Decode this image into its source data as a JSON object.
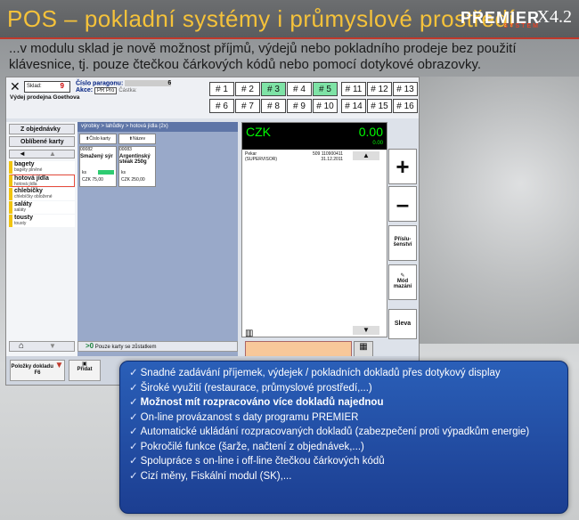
{
  "header": {
    "title": "POS – pokladní systémy i průmyslové prostředí",
    "brand": "PREMIER",
    "brand_sub": "SYSTEM",
    "version": "X4.2"
  },
  "intro_text": "...v modulu sklad je nově možnost příjmů, výdejů nebo pokladního prodeje bez použití klávesnice, tj. pouze čtečkou čárkových kódů nebo pomocí dotykové obrazovky.",
  "app": {
    "sklad_label": "Sklad:",
    "sklad_value": "9",
    "paragon_label": "Číslo paragonu:",
    "paragon_value": "6",
    "akce_label": "Akce:",
    "akce_value": "PR Pro",
    "castka_label": "Částka:",
    "vydej_label": "Výdej prodejna Goethova",
    "numkeys": [
      "# 1",
      "# 2",
      "# 3",
      "# 4",
      "# 5",
      "# 11",
      "# 12",
      "# 13",
      "# 6",
      "# 7",
      "# 8",
      "# 9",
      "# 10",
      "# 14",
      "# 15",
      "# 16"
    ],
    "left": {
      "objednavky": "Z objednávky",
      "oblibene": "Oblíbené karty",
      "categories": [
        {
          "name": "bagety",
          "sub": "bagety plněné"
        },
        {
          "name": "hotová jídla",
          "sub": "hotová jídla"
        },
        {
          "name": "chlebíčky",
          "sub": "chlebíčky obložené"
        },
        {
          "name": "saláty",
          "sub": "saláty"
        },
        {
          "name": "tousty",
          "sub": "tousty"
        }
      ]
    },
    "mid": {
      "crumb": "výrobky > lahůdky     > hotová jídla (2x)",
      "sort_code": "Číslo karty",
      "sort_name": "Název",
      "cards": [
        {
          "code": "00082",
          "name": "Smažený sýr",
          "qty": "ks",
          "price": "CZK  75,00"
        },
        {
          "code": "00083",
          "name": "Argentinský steak 250g",
          "qty": "ks",
          "price": "CZK  250,00"
        }
      ],
      "footer": "Pouze karty se zůstatkem"
    },
    "display": {
      "currency": "CZK",
      "amount": "0.00",
      "small": "0.00",
      "seller": "Pekar\n(SUPERVISOR)",
      "doc": "509 110900411",
      "date": "31.12.2011"
    },
    "ops": {
      "plus": "+",
      "minus": "–",
      "prislusenstvi": "Přís­lu­šenství",
      "mod_mazani": "Mód mazání",
      "sleva": "Sleva"
    },
    "bottom": {
      "polozky": "Položky dokladu",
      "f6": "F6",
      "pridat": "Přidat"
    }
  },
  "features": [
    "Snadné zadávání příjemek, výdejek / pokladních dokladů přes dotykový display",
    "Široké využití (restaurace, průmyslové prostředí,...)",
    "Možnost mít rozpracováno více dokladů najednou",
    "On-line provázanost s daty programu PREMIER",
    "Automatické ukládání rozpracovaných dokladů (zabezpečení proti výpadkům energie)",
    "Pokročilé funkce (šarže, načtení z objednávek,...)",
    "Spolupráce s on-line i off-line čtečkou čárkových kódů",
    "Cizí měny, Fiskální modul (SK),..."
  ]
}
